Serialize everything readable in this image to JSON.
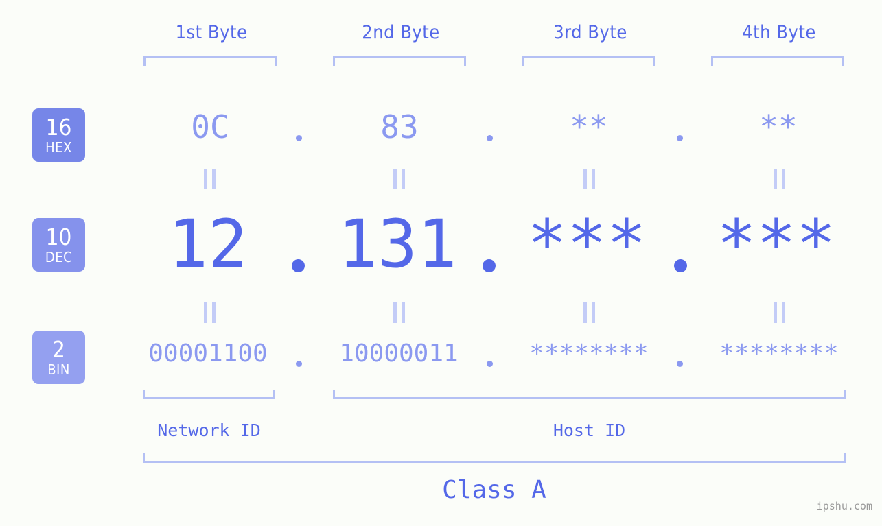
{
  "page": {
    "background_color": "#fbfdf9",
    "accent_color": "#5468e8",
    "accent_light_color": "#8b99f0",
    "bracket_color": "#b4c0f4"
  },
  "byte_headers": [
    {
      "label": "1st Byte"
    },
    {
      "label": "2nd Byte"
    },
    {
      "label": "3rd Byte"
    },
    {
      "label": "4th Byte"
    }
  ],
  "bases": [
    {
      "number": "16",
      "name": "HEX",
      "color": "#7686e8"
    },
    {
      "number": "10",
      "name": "DEC",
      "color": "#8592ec"
    },
    {
      "number": "2",
      "name": "BIN",
      "color": "#94a0f0"
    }
  ],
  "rows": {
    "hex": {
      "base_number": "16",
      "base_name": "HEX",
      "values": [
        "0C",
        "83",
        "**",
        "**"
      ],
      "separator": "."
    },
    "dec": {
      "base_number": "10",
      "base_name": "DEC",
      "values": [
        "12",
        "131",
        "***",
        "***"
      ],
      "separator": "."
    },
    "bin": {
      "base_number": "2",
      "base_name": "BIN",
      "values": [
        "00001100",
        "10000011",
        "********",
        "********"
      ],
      "separator": "."
    }
  },
  "equality_mark": "||",
  "segments": {
    "network_id": "Network ID",
    "host_id": "Host ID"
  },
  "class": {
    "label": "Class A"
  },
  "watermark": {
    "text": "ipshu.com"
  }
}
